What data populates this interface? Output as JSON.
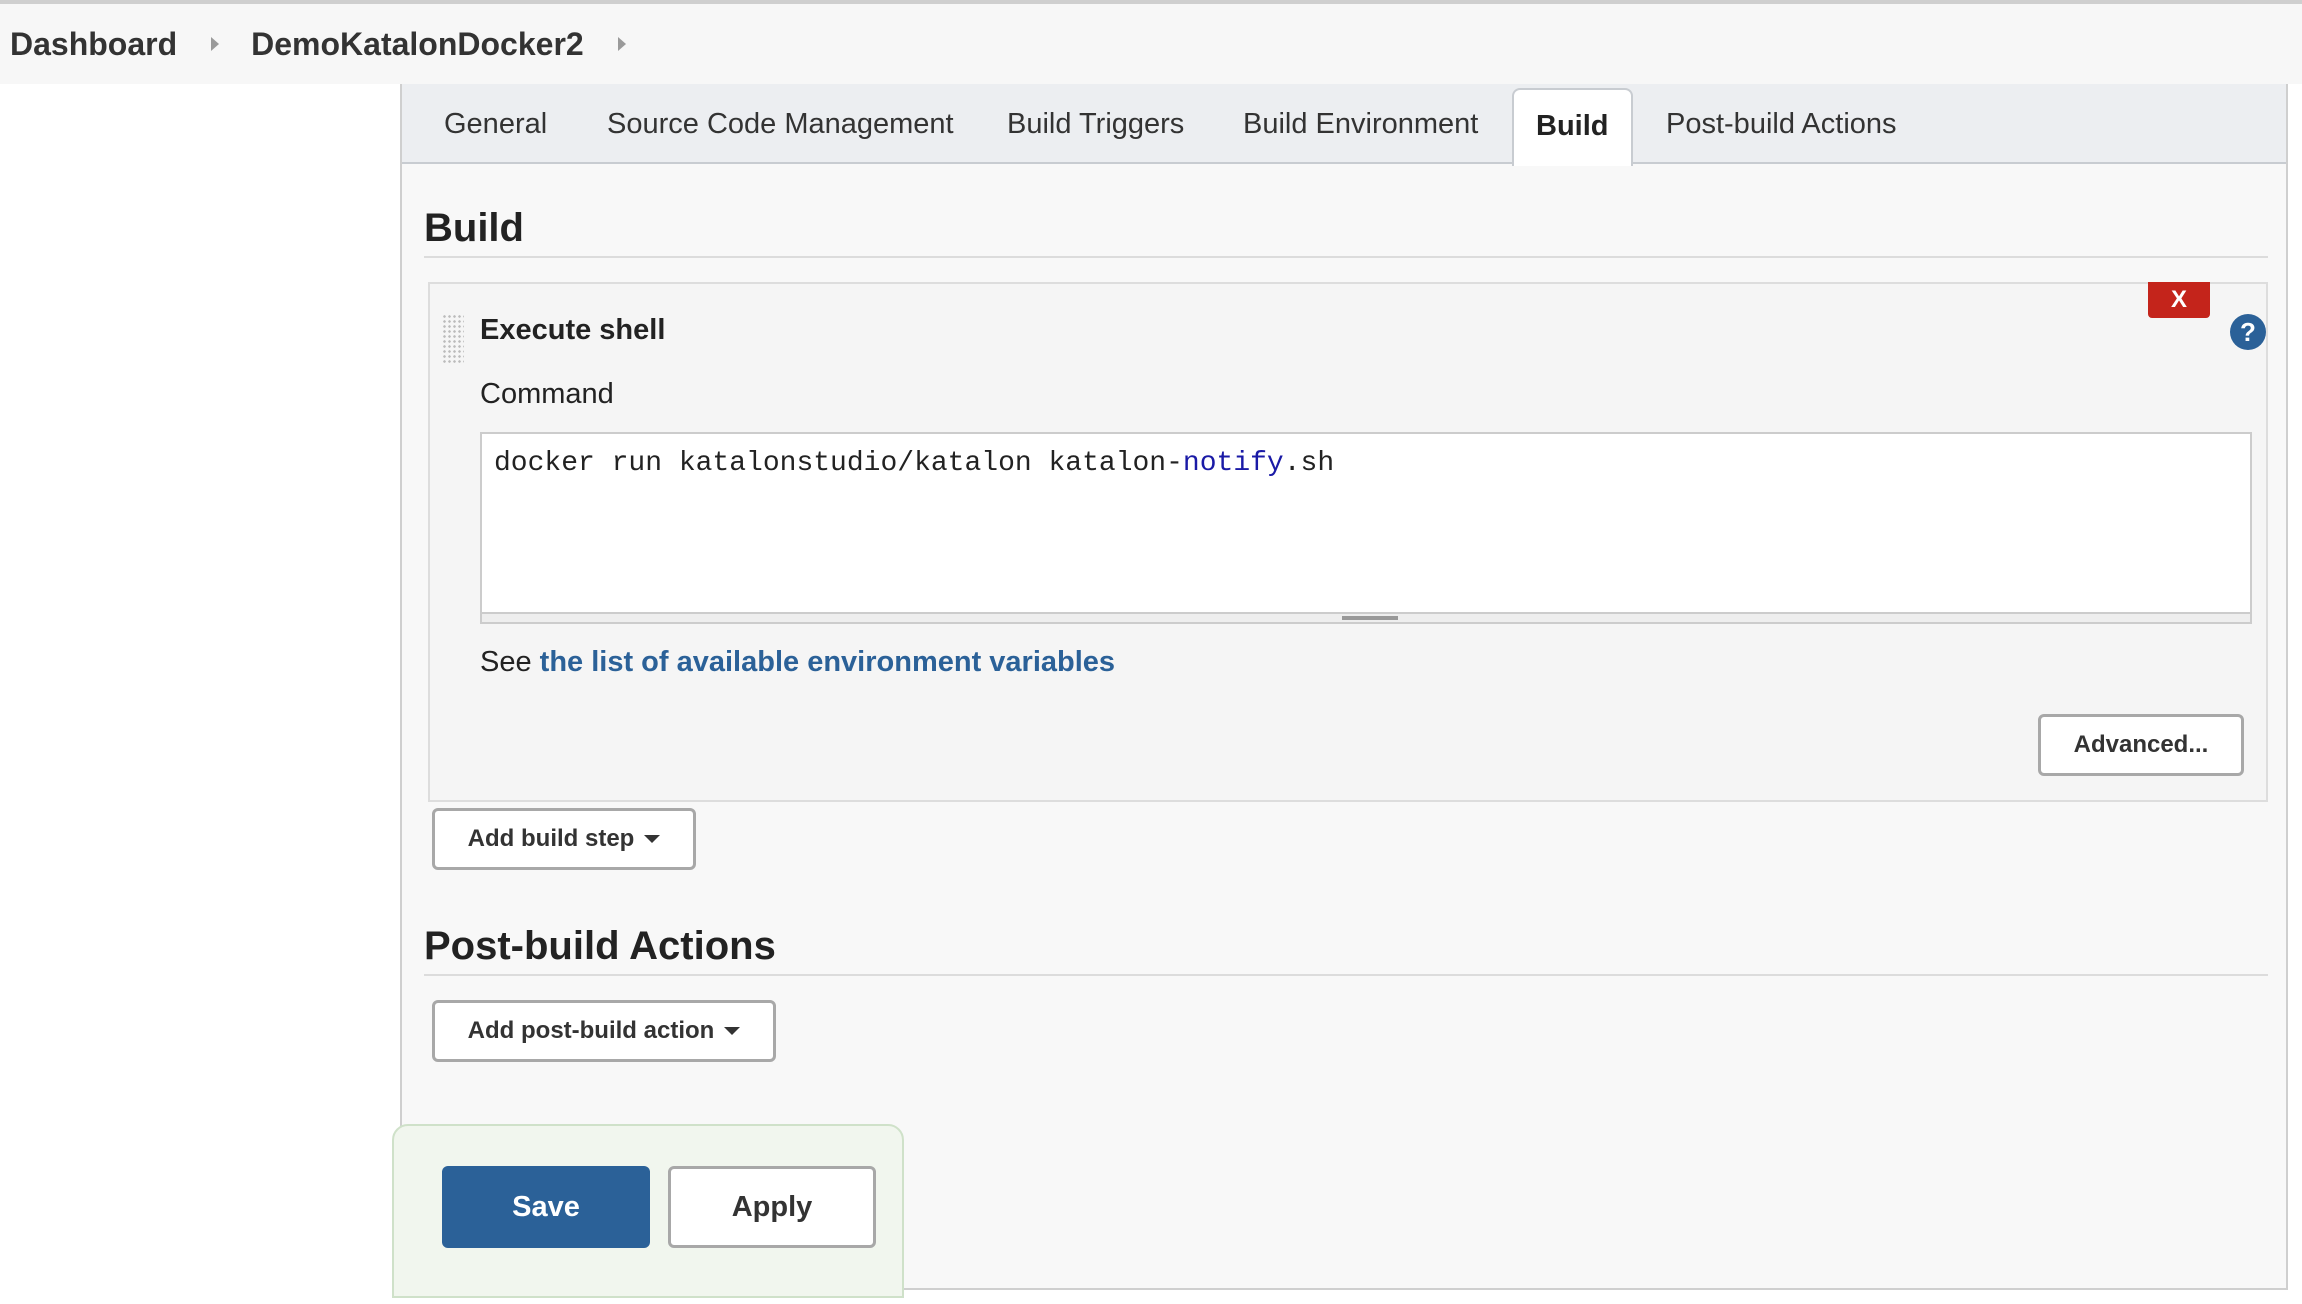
{
  "breadcrumb": {
    "items": [
      "Dashboard",
      "DemoKatalonDocker2"
    ]
  },
  "tabs": [
    {
      "label": "General",
      "active": false
    },
    {
      "label": "Source Code Management",
      "active": false
    },
    {
      "label": "Build Triggers",
      "active": false
    },
    {
      "label": "Build Environment",
      "active": false
    },
    {
      "label": "Build",
      "active": true
    },
    {
      "label": "Post-build Actions",
      "active": false
    }
  ],
  "build_section": {
    "title": "Build",
    "step": {
      "title": "Execute shell",
      "delete_label": "X",
      "help_label": "?",
      "command_label": "Command",
      "command_parts": {
        "before": "docker run katalonstudio/katalon katalon-",
        "keyword": "notify",
        "after": ".sh"
      },
      "env_prefix": "See",
      "env_link": "the list of available environment variables",
      "advanced_label": "Advanced..."
    },
    "add_step_label": "Add build step"
  },
  "post_build_section": {
    "title": "Post-build Actions",
    "add_action_label": "Add post-build action"
  },
  "footer": {
    "save_label": "Save",
    "apply_label": "Apply"
  },
  "colors": {
    "accent": "#2b6198",
    "danger": "#c4241b",
    "save_bar_bg": "#f1f6ee"
  }
}
